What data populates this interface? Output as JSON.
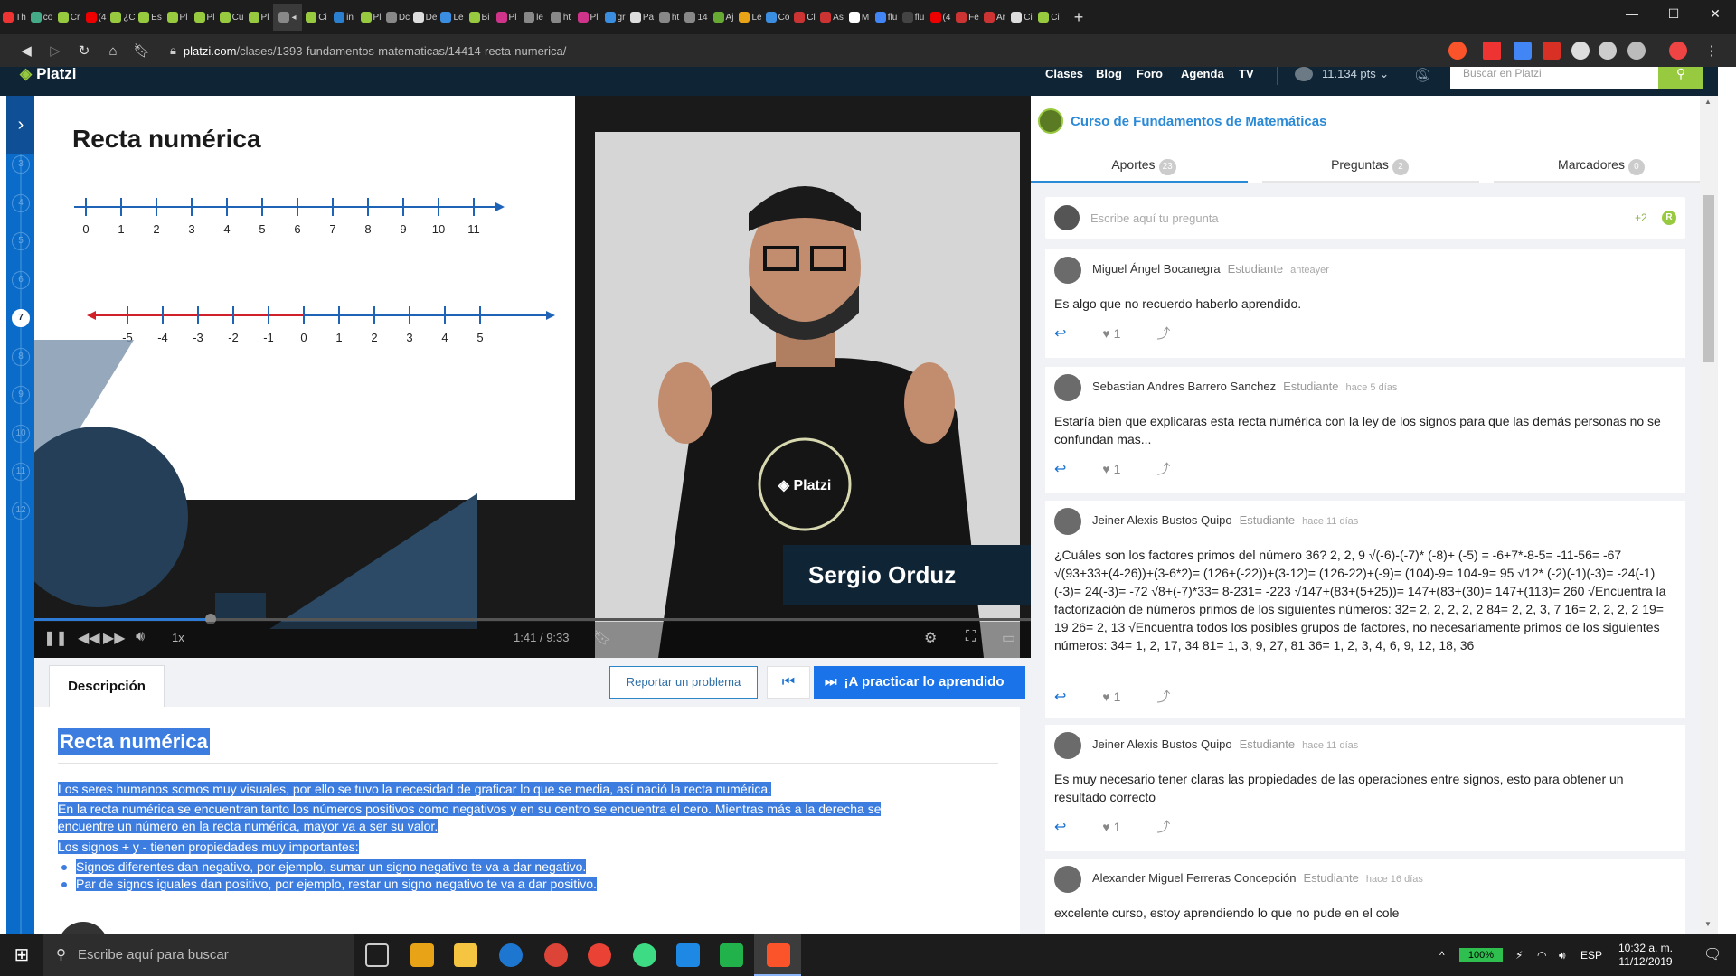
{
  "browser": {
    "tabs": [
      {
        "label": "Th",
        "color": "#e33"
      },
      {
        "label": "co",
        "color": "#4a8"
      },
      {
        "label": "Cr",
        "color": "#98ca3f"
      },
      {
        "label": "(4",
        "color": "#e00"
      },
      {
        "label": "¿C",
        "color": "#98ca3f"
      },
      {
        "label": "Es",
        "color": "#98ca3f"
      },
      {
        "label": "Pl",
        "color": "#98ca3f"
      },
      {
        "label": "Pl",
        "color": "#98ca3f"
      },
      {
        "label": "Cu",
        "color": "#98ca3f"
      },
      {
        "label": "Pl",
        "color": "#98ca3f"
      },
      {
        "label": "◂",
        "color": "#888"
      },
      {
        "label": "Ci",
        "color": "#98ca3f"
      },
      {
        "label": "in",
        "color": "#2a7fcf"
      },
      {
        "label": "Pl",
        "color": "#98ca3f"
      },
      {
        "label": "Dc",
        "color": "#888"
      },
      {
        "label": "De",
        "color": "#ddd"
      },
      {
        "label": "Le",
        "color": "#3b8de0"
      },
      {
        "label": "Bi",
        "color": "#98ca3f"
      },
      {
        "label": "Pl",
        "color": "#d0338a"
      },
      {
        "label": "le",
        "color": "#888"
      },
      {
        "label": "ht",
        "color": "#888"
      },
      {
        "label": "Pl",
        "color": "#d0338a"
      },
      {
        "label": "gr",
        "color": "#3b8de0"
      },
      {
        "label": "Pa",
        "color": "#ddd"
      },
      {
        "label": "ht",
        "color": "#888"
      },
      {
        "label": "14",
        "color": "#888"
      },
      {
        "label": "Aj",
        "color": "#6a3"
      },
      {
        "label": "Le",
        "color": "#e8a317"
      },
      {
        "label": "Co",
        "color": "#3b8de0"
      },
      {
        "label": "Cl",
        "color": "#c33"
      },
      {
        "label": "As",
        "color": "#c33"
      },
      {
        "label": "M",
        "color": "#fff"
      },
      {
        "label": "flu",
        "color": "#4285f4"
      },
      {
        "label": "flu",
        "color": "#444"
      },
      {
        "label": "(4",
        "color": "#e00"
      },
      {
        "label": "Fe",
        "color": "#c33"
      },
      {
        "label": "Ar",
        "color": "#c33"
      },
      {
        "label": "Ci",
        "color": "#ddd"
      },
      {
        "label": "Ci",
        "color": "#98ca3f"
      }
    ],
    "url_host": "platzi.com",
    "url_path": "/clases/1393-fundamentos-matematicas/14414-recta-numerica/",
    "new_tab": "+",
    "minimize": "—",
    "maximize": "☐",
    "close": "✕"
  },
  "header": {
    "logo": "Platzi",
    "nav": [
      "Clases",
      "Blog",
      "Foro",
      "Agenda",
      "TV"
    ],
    "points": "11.134 pts",
    "search_placeholder": "Buscar en Platzi"
  },
  "rail": {
    "toggle": "›",
    "classes": [
      "3",
      "4",
      "5",
      "6",
      "7",
      "8",
      "9",
      "10",
      "11",
      "12"
    ],
    "current": "7"
  },
  "video": {
    "slide_title": "Recta numérica",
    "line1_ticks": [
      "0",
      "1",
      "2",
      "3",
      "4",
      "5",
      "6",
      "7",
      "8",
      "9",
      "10",
      "11"
    ],
    "line2_ticks": [
      "-5",
      "-4",
      "-3",
      "-2",
      "-1",
      "0",
      "1",
      "2",
      "3",
      "4",
      "5"
    ],
    "presenter": "Sergio Orduz",
    "speed": "1x",
    "time_current": "1:41",
    "time_sep": "/",
    "time_total": "9:33",
    "progress": 0.177
  },
  "below": {
    "tab_description": "Descripción",
    "report_button": "Reportar un problema",
    "practice_button": "¡A practicar lo aprendido",
    "desc_title": "Recta numérica",
    "desc_p1": "Los seres humanos somos muy visuales, por ello se tuvo la necesidad de graficar lo que se media, así nació la recta numérica.",
    "desc_p2a": "En la recta numérica se encuentran tanto los números positivos como negativos y en su centro se encuentra el cero. Mientras más a la derecha se",
    "desc_p2b": "encuentre un número en la recta numérica, mayor va a ser su valor.",
    "desc_p3": "Los signos + y - tienen propiedades muy importantes:",
    "desc_li1": "Signos diferentes dan negativo, por ejemplo, sumar un signo negativo te va a dar negativo.",
    "desc_li2": "Par de signos iguales dan positivo, por ejemplo, restar un signo negativo te va a dar positivo."
  },
  "panel": {
    "course_title": "Curso de Fundamentos de Matemáticas",
    "tabs": [
      {
        "label": "Aportes",
        "count": "23"
      },
      {
        "label": "Preguntas",
        "count": "2"
      },
      {
        "label": "Marcadores",
        "count": "0"
      }
    ],
    "input_placeholder": "Escribe aquí tu pregunta",
    "input_points": "+2",
    "input_badge": "R",
    "comments": [
      {
        "name": "Miguel Ángel Bocanegra",
        "role": "Estudiante",
        "time": "anteayer",
        "body": "Es algo que no recuerdo haberlo aprendido.",
        "likes": "1"
      },
      {
        "name": "Sebastian Andres Barrero Sanchez",
        "role": "Estudiante",
        "time": "hace 5 días",
        "body": "Estaría bien que explicaras esta recta numérica con la ley de los signos para que las demás personas no se confundan mas...",
        "likes": "1"
      },
      {
        "name": "Jeiner Alexis Bustos Quipo",
        "role": "Estudiante",
        "time": "hace 11 días",
        "body": "¿Cuáles son los factores primos del número 36? 2, 2, 9 √(-6)-(-7)* (-8)+ (-5) = -6+7*-8-5= -11-56= -67 √(93+33+(4-26))+(3-6*2)= (126+(-22))+(3-12)= (126-22)+(-9)= (104)-9= 104-9= 95 √12* (-2)(-1)(-3)= -24(-1)(-3)= 24(-3)= -72 √8+(-7)*33= 8-231= -223 √147+(83+(5+25))= 147+(83+(30)= 147+(113)= 260 √Encuentra la factorización de números primos de los siguientes números: 32= 2, 2, 2, 2, 2 84= 2, 2, 3, 7 16= 2, 2, 2, 2 19= 19 26= 2, 13 √Encuentra todos los posibles grupos de factores, no necesariamente primos de los siguientes números: 34= 1, 2, 17, 34 81= 1, 3, 9, 27, 81 36= 1, 2, 3, 4, 6, 9, 12, 18, 36",
        "likes": "1"
      },
      {
        "name": "Jeiner Alexis Bustos Quipo",
        "role": "Estudiante",
        "time": "hace 11 días",
        "body": "Es muy necesario tener claras las propiedades de las operaciones entre signos, esto para obtener un resultado correcto",
        "likes": "1"
      },
      {
        "name": "Alexander Miguel Ferreras Concepción",
        "role": "Estudiante",
        "time": "hace 16 días",
        "body": "excelente curso, estoy aprendiendo lo que no pude en el cole",
        "likes": ""
      }
    ]
  },
  "taskbar": {
    "search_placeholder": "Escribe aquí para buscar",
    "battery": "100%",
    "lang": "ESP",
    "time": "10:32 a. m.",
    "date": "11/12/2019"
  },
  "colors": {
    "platzi_green": "#98ca3f",
    "platzi_navy": "#0f2536",
    "rail_blue": "#0b6bc9",
    "accent_blue": "#1a73e8"
  }
}
